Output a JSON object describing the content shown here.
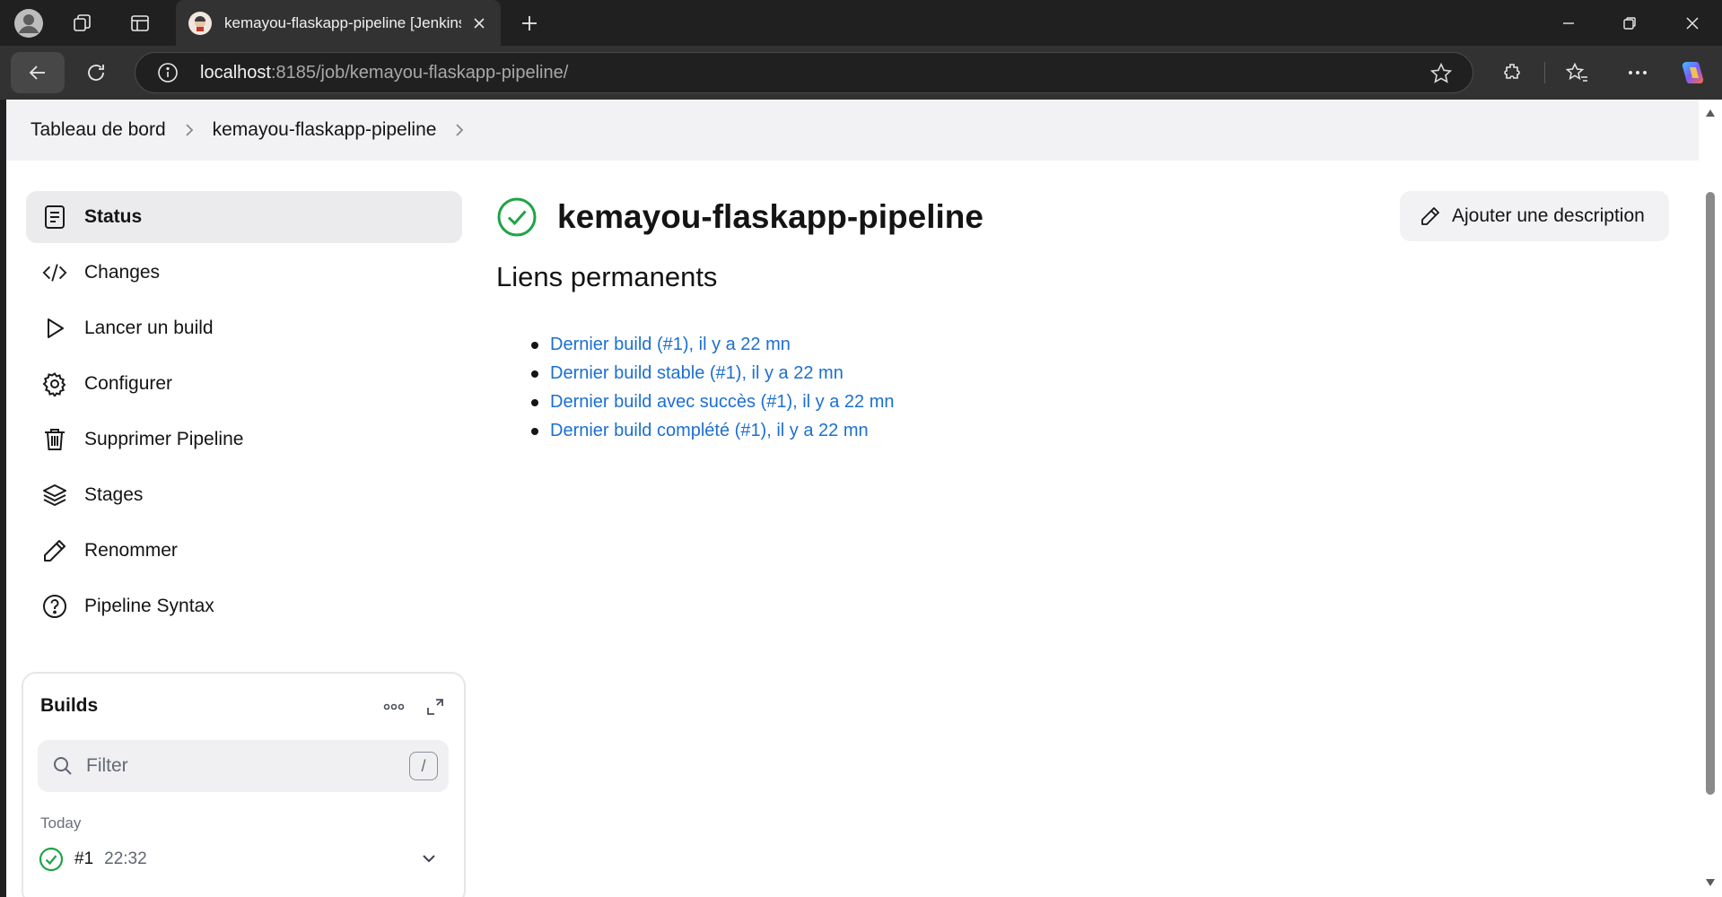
{
  "browser": {
    "tab_title": "kemayou-flaskapp-pipeline [Jenkins]",
    "url_host": "localhost",
    "url_path": ":8185/job/kemayou-flaskapp-pipeline/",
    "icons": [
      "profile-icon",
      "workspaces-icon",
      "tab-actions-icon",
      "new-tab-icon",
      "minimize-icon",
      "restore-icon",
      "close-window-icon",
      "back-icon",
      "refresh-icon",
      "info-icon",
      "star-icon",
      "extensions-icon",
      "favorites-icon",
      "more-icon",
      "copilot-icon"
    ]
  },
  "breadcrumb": {
    "items": [
      "Tableau de bord",
      "kemayou-flaskapp-pipeline"
    ]
  },
  "sidebar": {
    "items": [
      {
        "label": "Status",
        "icon": "document-icon",
        "active": true
      },
      {
        "label": "Changes",
        "icon": "code-icon"
      },
      {
        "label": "Lancer un build",
        "icon": "play-icon"
      },
      {
        "label": "Configurer",
        "icon": "gear-icon"
      },
      {
        "label": "Supprimer Pipeline",
        "icon": "trash-icon"
      },
      {
        "label": "Stages",
        "icon": "layers-icon"
      },
      {
        "label": "Renommer",
        "icon": "pencil-icon"
      },
      {
        "label": "Pipeline Syntax",
        "icon": "help-icon"
      }
    ]
  },
  "builds": {
    "title": "Builds",
    "filter_placeholder": "Filter",
    "shortcut": "/",
    "group_label": "Today",
    "rows": [
      {
        "number": "#1",
        "time": "22:32",
        "status": "success"
      }
    ]
  },
  "main": {
    "title": "kemayou-flaskapp-pipeline",
    "description_button": "Ajouter une description",
    "permalinks_heading": "Liens permanents",
    "permalinks": [
      "Dernier build (#1), il y a 22 mn",
      "Dernier build stable (#1), il y a 22 mn",
      "Dernier build avec succès (#1), il y a 22 mn",
      "Dernier build complété (#1), il y a 22 mn"
    ]
  },
  "colors": {
    "success": "#1ea446",
    "link": "#1c6fd1",
    "chrome_dark": "#202020",
    "chrome_tab": "#323232"
  }
}
